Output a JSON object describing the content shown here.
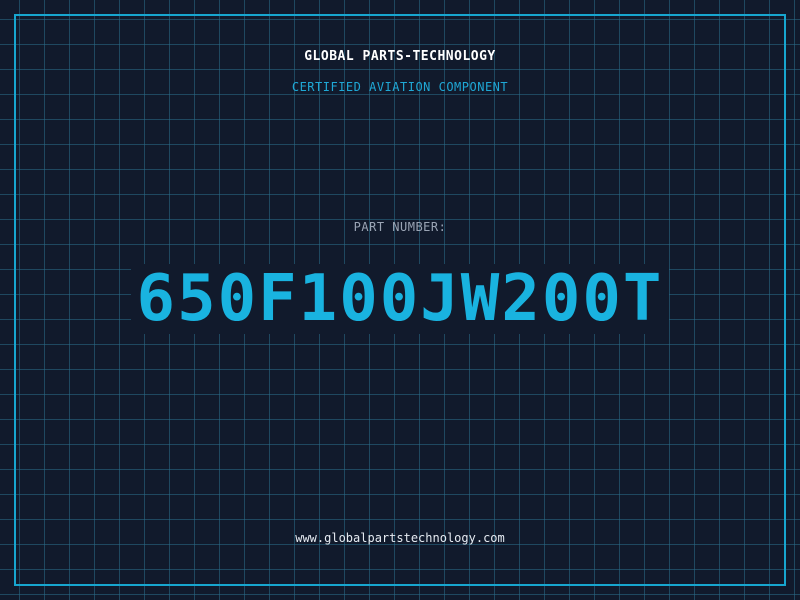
{
  "header": {
    "company": "GLOBAL PARTS-TECHNOLOGY",
    "tagline": "CERTIFIED AVIATION COMPONENT"
  },
  "part": {
    "label": "PART NUMBER:",
    "number": "650F100JW200T"
  },
  "footer": {
    "website": "www.globalpartstechnology.com"
  },
  "colors": {
    "background": "#111a2c",
    "grid": "#2a6e8a",
    "accent": "#19b3e0",
    "frame": "#17a6cf"
  }
}
